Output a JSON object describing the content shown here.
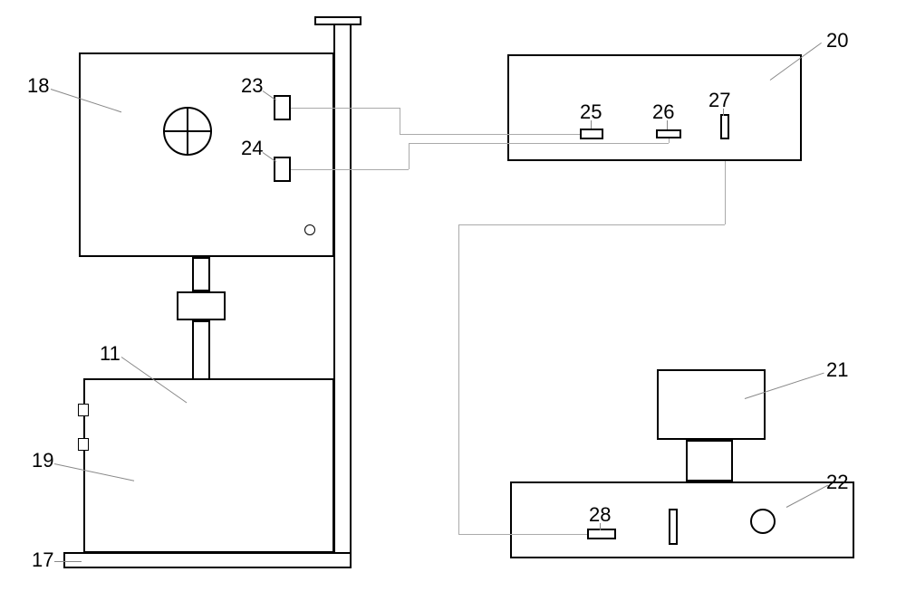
{
  "labels": {
    "n11": "11",
    "n17": "17",
    "n18": "18",
    "n19": "19",
    "n20": "20",
    "n21": "21",
    "n22": "22",
    "n23": "23",
    "n24": "24",
    "n25": "25",
    "n26": "26",
    "n27": "27",
    "n28": "28"
  }
}
